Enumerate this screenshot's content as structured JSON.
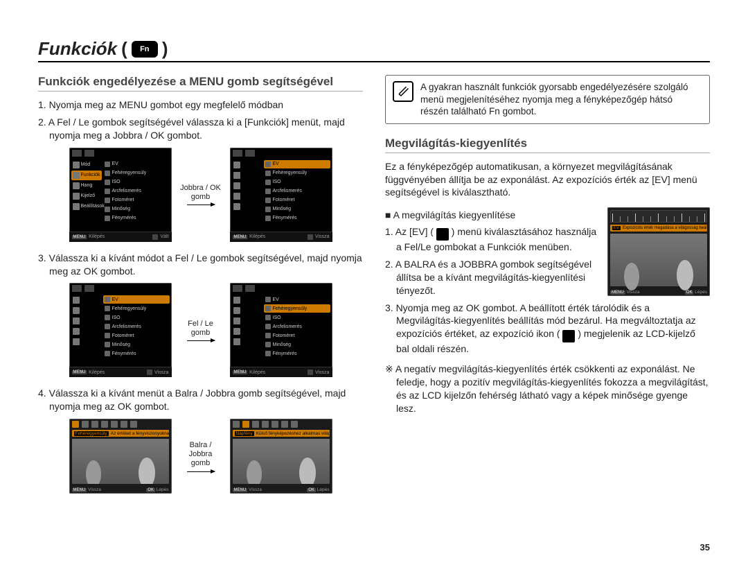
{
  "page": {
    "title": "Funkciók",
    "icon_label": "Fn",
    "number": "35"
  },
  "left": {
    "subtitle": "Funkciók engedélyezése a MENU gomb segítségével",
    "step1": "1. Nyomja meg az MENU gombot egy megfelelő módban",
    "step2": "2. A Fel / Le gombok segítségével válassza ki a [Funkciók] menüt, majd nyomja meg a Jobbra / OK gombot.",
    "step3": "3. Válassza ki a kívánt módot a Fel / Le gombok segítségével, majd nyomja meg az OK gombot.",
    "step4": "4. Válassza ki a kívánt menüt a Balra / Jobbra gomb segítségével, majd nyomja meg az OK gombot.",
    "arrow1": "Jobbra / OK gomb",
    "arrow2": "Fel / Le gomb",
    "arrow3": "Balra / Jobbra gomb",
    "side_items": [
      "Mód",
      "Funkciók",
      "Hang",
      "Kijelző",
      "Beállítások"
    ],
    "list_items": [
      "EV",
      "Fehéregyensúly",
      "ISO",
      "Arcfelismerés",
      "Fotoméret",
      "Minőség",
      "Fénymérés"
    ],
    "foot_exit": "Kilépés",
    "foot_change": "Vált",
    "foot_back": "Vissza",
    "foot_step": "Lépés",
    "foot_menu": "MENU",
    "wb_bar_left_label": "Fehéregyensúly",
    "wb_bar_left_desc": "Az értéket a fényviszonyoknak megfelelően állítja be.",
    "wb_bar_right_label": "Napfény",
    "wb_bar_right_desc": "Külső fényképezéshez alkalmas világos nappal."
  },
  "right": {
    "tip": "A gyakran használt funkciók gyorsabb engedélyezésére szolgáló menü megjelenítéséhez nyomja meg a fényképezőgép hátsó részén található Fn gombot.",
    "subtitle": "Megvilágítás-kiegyenlítés",
    "intro": "Ez a fényképezőgép automatikusan, a környezet megvilágításának függvényében állítja be az exponálást. Az expozíciós érték az [EV] menü segítségével is kiválasztható.",
    "bullet": "A megvilágítás kiegyenlítése",
    "step1a": "1. Az [EV] ( ",
    "step1b": " ) menü kiválasztásához használja a Fel/Le gombokat a Funkciók menüben.",
    "step2": "2. A BALRA és a JOBBRA gombok segítségével állítsa be a kívánt megvilágítás-kiegyenlítési tényezőt.",
    "step3a": "3. Nyomja meg az OK gombot. A beállított érték tárolódik és a Megvilágítás-kiegyenlítés beállítás mód bezárul. Ha megváltoztatja az expozíciós értéket, az expozíció ikon ( ",
    "step3b": " ) megjelenik az LCD-kijelző bal oldali részén.",
    "note": "※ A negatív megvilágítás-kiegyenlítés érték csökkenti az exponálást. Ne feledje, hogy a pozitív megvilágítás-kiegyenlítés fokozza a megvilágítást, és az LCD kijelzőn fehérség látható vagy a képek minősége gyenge lesz.",
    "ev_bar_label": "EV",
    "ev_bar_desc": "Expozíciós érték megadása a világosság beállításához."
  }
}
